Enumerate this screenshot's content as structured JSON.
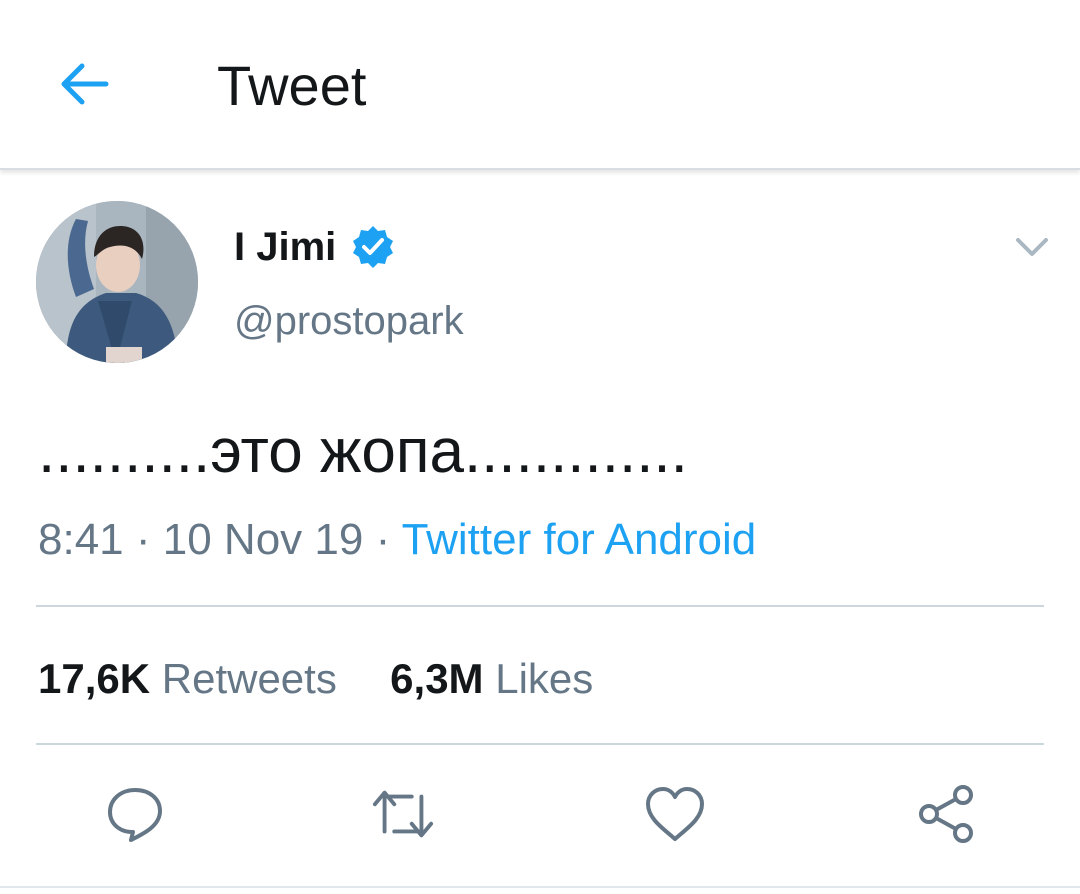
{
  "appbar": {
    "back_icon": "arrow-left-icon",
    "title": "Tweet"
  },
  "colors": {
    "accent": "#1da1f2",
    "text_primary": "#14171a",
    "text_secondary": "#657786",
    "divider": "#ccd6dd"
  },
  "tweet": {
    "author": {
      "display_name": "I Jimi",
      "verified_icon": "verified-badge-icon",
      "handle": "@prostopark"
    },
    "menu_icon": "chevron-down-icon",
    "text": "..........это жопа.............",
    "time": "8:41",
    "date": "10 Nov 19",
    "separator": "·",
    "source": "Twitter for Android",
    "retweets_count": "17,6K",
    "retweets_label": "Retweets",
    "likes_count": "6,3M",
    "likes_label": "Likes"
  },
  "actions": [
    {
      "icon": "reply-icon"
    },
    {
      "icon": "retweet-icon"
    },
    {
      "icon": "like-heart-icon"
    },
    {
      "icon": "share-icon"
    }
  ]
}
